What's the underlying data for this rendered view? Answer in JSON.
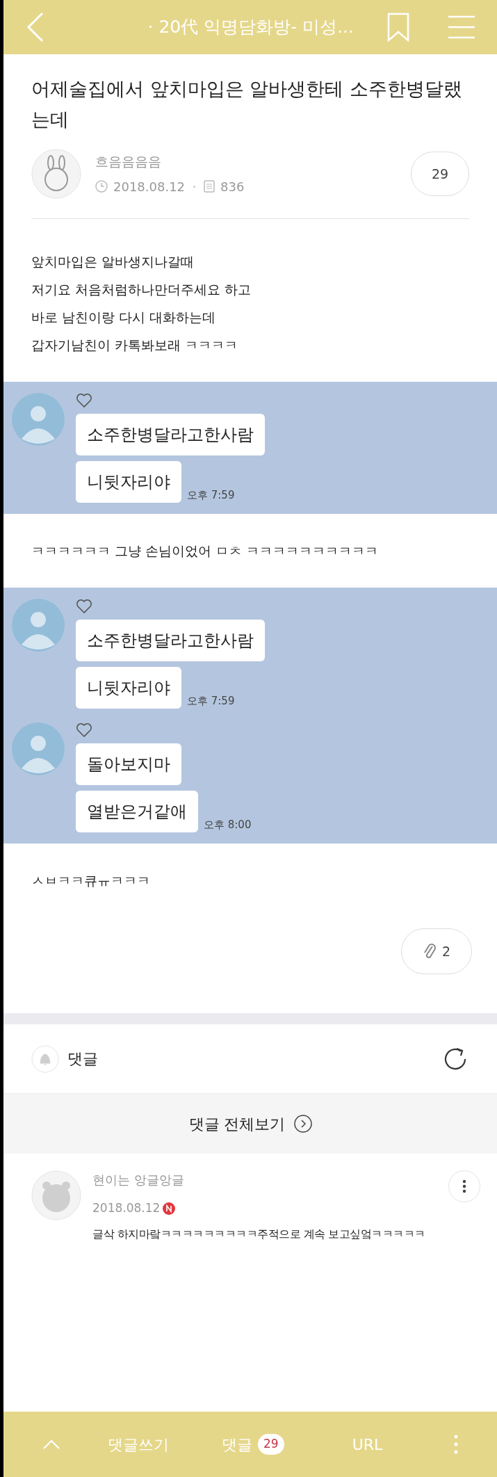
{
  "header": {
    "title": "· 20代 익명담화방- 미성..."
  },
  "post": {
    "title": "어제술집에서 앞치마입은 알바생한테 소주한병달랬는데",
    "author": "흐음음음음",
    "date": "2018.08.12",
    "views": "836",
    "comment_count": "29"
  },
  "content": [
    {
      "kind": "text",
      "lines": [
        "앞치마입은 알바생지나갈때",
        "저기요 처음처럼하나만더주세요 하고",
        "바로 남친이랑 다시 대화하는데",
        "갑자기남친이 카톡봐보래 ㅋㅋㅋㅋ"
      ]
    },
    {
      "kind": "chat",
      "groups": [
        {
          "bubbles": [
            "소주한병달라고한사람",
            "니뒷자리야"
          ],
          "time": "오후 7:59"
        }
      ]
    },
    {
      "kind": "text",
      "lines": [
        "ㅋㅋㅋㅋㅋㅋ 그냥 손님이었어 ㅁㅊ ㅋㅋㅋㅋㅋㅋㅋㅋㅋㅋ"
      ]
    },
    {
      "kind": "chat",
      "groups": [
        {
          "bubbles": [
            "소주한병달라고한사람",
            "니뒷자리야"
          ],
          "time": "오후 7:59"
        },
        {
          "bubbles": [
            "돌아보지마",
            "열받은거같애"
          ],
          "time": "오후 8:00"
        }
      ]
    },
    {
      "kind": "text",
      "lines": [
        "ㅅㅂㅋㅋ큐ㅠㅋㅋㅋ"
      ]
    }
  ],
  "attachments": {
    "count": "2"
  },
  "comments_section": {
    "title": "댓글",
    "view_all": "댓글 전체보기"
  },
  "comments": [
    {
      "author": "현이는 앙글앙글",
      "date": "2018.08.12",
      "new": true,
      "text": "글삭 하지마랔ㅋㅋㅋㅋㅋㅋㅋㅋㅋ주적으로 계속 보고싶엌ㅋㅋㅋㅋㅋ"
    }
  ],
  "bottom_bar": {
    "write": "댓글쓰기",
    "comments": "댓글",
    "count": "29",
    "url": "URL"
  }
}
